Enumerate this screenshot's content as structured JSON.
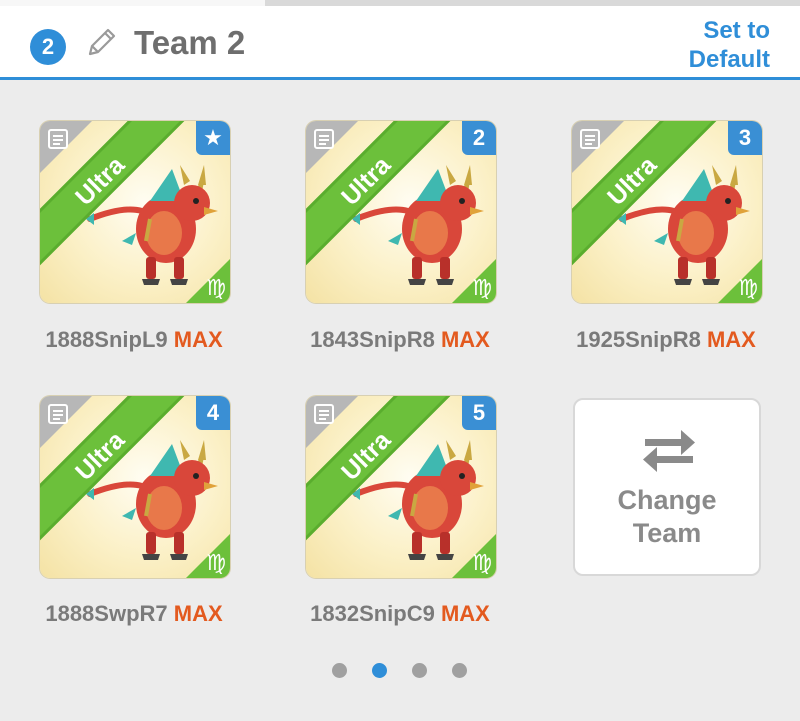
{
  "header": {
    "team_number": "2",
    "team_title": "Team 2",
    "set_default_label": "Set to Default"
  },
  "colors": {
    "accent": "#2f8ed8",
    "ribbon_green": "#6cc03b",
    "max_orange": "#e35a1f"
  },
  "cards": [
    {
      "ribbon": "Ultra",
      "slot": "★",
      "slot_icon": "star-icon",
      "zodiac": "♍",
      "name": "1888SnipL9",
      "level": "MAX"
    },
    {
      "ribbon": "Ultra",
      "slot": "2",
      "zodiac": "♍",
      "name": "1843SnipR8",
      "level": "MAX"
    },
    {
      "ribbon": "Ultra",
      "slot": "3",
      "zodiac": "♍",
      "name": "1925SnipR8",
      "level": "MAX"
    },
    {
      "ribbon": "Ultra",
      "slot": "4",
      "zodiac": "♍",
      "name": "1888SwpR7",
      "level": "MAX"
    },
    {
      "ribbon": "Ultra",
      "slot": "5",
      "zodiac": "♍",
      "name": "1832SnipC9",
      "level": "MAX"
    }
  ],
  "change_team": {
    "label_line1": "Change",
    "label_line2": "Team",
    "icon": "swap-arrows-icon"
  },
  "pagination": {
    "total": 4,
    "active_index": 1
  }
}
